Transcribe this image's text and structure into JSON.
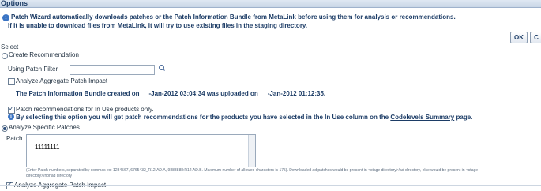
{
  "header": {
    "title": "Options"
  },
  "info": {
    "line1": "Patch Wizard automatically downloads patches or the Patch Information Bundle from MetaLink before using them for analysis or recommendations.",
    "line2": "If it is unable to download files from MetaLink, it will try to use existing files in the staging directory."
  },
  "buttons": {
    "ok": "OK",
    "cancel": "C"
  },
  "select_label": "Select",
  "create_recommendation": {
    "label": "Create Recommendation",
    "checked": false,
    "patch_filter_label": "Using Patch Filter",
    "patch_filter_value": "",
    "analyze_aggregate_label": "Analyze Aggregate Patch Impact",
    "analyze_aggregate_checked": false,
    "bundle_prefix": "The Patch Information Bundle created on",
    "bundle_date1": "-Jan-2012 03:04:34 was uploaded on",
    "bundle_date2": "-Jan-2012 01:12:35.",
    "inuse_label": "Patch recommendations for In Use products only.",
    "inuse_checked": true,
    "inuse_note_prefix": "By selecting this option you will get patch recommendations for the products you have selected in the In Use column on the",
    "inuse_note_link": "Codelevels Summary",
    "inuse_note_suffix": "page."
  },
  "analyze_specific": {
    "label": "Analyze Specific Patches",
    "checked": true,
    "patch_label": "Patch",
    "patch_value": "11111111",
    "hint_line1": "(Enter Patch numbers, separated by commas ex: 1234567, 6765432_R12.AD.A, 9888888:R12.AD.B. Maximum number of allowed characters is 175). Downloaded ad patches would be present in <stage directory>/ad directory, else would be present in <stage",
    "hint_line2": "directory>/nonad directory",
    "analyze_aggregate_label": "Analyze Aggregate Patch Impact",
    "analyze_aggregate_checked": true
  },
  "colors": {
    "accent": "#1c3c66",
    "info_icon": "#3a74c4",
    "header_band": "#c9d6e6"
  },
  "icons": [
    "info-icon",
    "search-icon"
  ]
}
